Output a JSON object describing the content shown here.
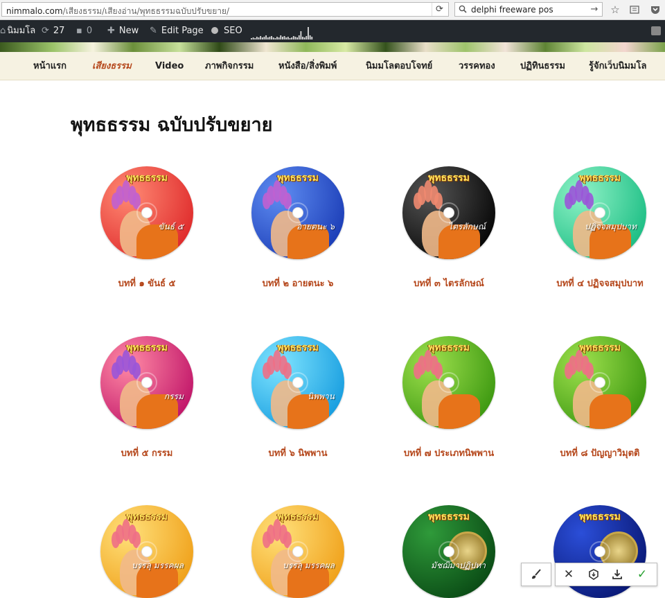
{
  "browser": {
    "url_host": "nimmalo.com",
    "url_path": "/เสียงธรรม/เสียงอ่าน/พุทธธรรมฉบับปรับขยาย/",
    "reload_glyph": "⟳",
    "search_query": "delphi freeware pos",
    "go_glyph": "→",
    "icons": [
      "star-icon",
      "reading-list-icon",
      "pocket-icon"
    ]
  },
  "admin_bar": {
    "site_name": "นิมมโล",
    "updates_count": "27",
    "comments_count": "0",
    "new_label": "New",
    "edit_label": "Edit Page",
    "seo_label": "SEO",
    "stats_bars": [
      2,
      3,
      2,
      4,
      3,
      5,
      3,
      4,
      6,
      3,
      4,
      5,
      3,
      2,
      4,
      3,
      6,
      4,
      5,
      3,
      4,
      2,
      3,
      5,
      4,
      3,
      6,
      12,
      4,
      3,
      5,
      18,
      6,
      4
    ]
  },
  "nav": {
    "items": [
      {
        "label": "หน้าแรก",
        "active": false
      },
      {
        "label": "เสียงธรรม",
        "active": true
      },
      {
        "label": "Video",
        "active": false
      },
      {
        "label": "ภาพกิจกรรม",
        "active": false
      },
      {
        "label": "หนังสือ/สิ่งพิมพ์",
        "active": false
      },
      {
        "label": "นิมมโลตอบโจทย์",
        "active": false
      },
      {
        "label": "วรรคทอง",
        "active": false
      },
      {
        "label": "ปฏิทินธรรม",
        "active": false
      },
      {
        "label": "รู้จักเว็บนิมมโล",
        "active": false
      }
    ]
  },
  "page": {
    "title": "พุทธธรรม ฉบับปรับขยาย"
  },
  "items": [
    {
      "caption": "บทที่ ๑ ขันธ์ ๕",
      "disc_label": "ขันธ์ ๕",
      "colors": [
        "#ff8a74",
        "#e02d2d"
      ],
      "flower": "#c060d0"
    },
    {
      "caption": "บทที่ ๒ อายตนะ ๖",
      "disc_label": "อายตนะ ๖",
      "colors": [
        "#5f8df2",
        "#1d3fb8"
      ],
      "flower": "#c060d0"
    },
    {
      "caption": "บทที่ ๓ ไตรลักษณ์",
      "disc_label": "ไตรลักษณ์",
      "colors": [
        "#555555",
        "#080808"
      ],
      "flower": "#f08a70"
    },
    {
      "caption": "บทที่ ๔ ปฏิจจสมุปบาท",
      "disc_label": "ปฏิจจสมุปบาท",
      "colors": [
        "#8ff2c6",
        "#1fbf86"
      ],
      "flower": "#9a55d8"
    },
    {
      "caption": "บทที่ ๕ กรรม",
      "disc_label": "กรรม",
      "colors": [
        "#ff8aa5",
        "#c2186a"
      ],
      "flower": "#9a55d8"
    },
    {
      "caption": "บทที่ ๖ นิพพาน",
      "disc_label": "นิพพาน",
      "colors": [
        "#7fe4ff",
        "#1a9fe0"
      ],
      "flower": "#ee6f86"
    },
    {
      "caption": "บทที่ ๗ ประเภทนิพพาน",
      "disc_label": "",
      "colors": [
        "#9ee04d",
        "#3f9a12"
      ],
      "flower": "#ee6f86"
    },
    {
      "caption": "บทที่ ๘ ปัญญาวิมุตติ",
      "disc_label": "",
      "colors": [
        "#9ee04d",
        "#3f9a12"
      ],
      "flower": "#ee6f86"
    },
    {
      "caption": "",
      "disc_label": "บรรลุ มรรคผล",
      "colors": [
        "#ffe07a",
        "#f0a21c"
      ],
      "flower": "#ee6f86"
    },
    {
      "caption": "",
      "disc_label": "บรรลุ มรรคผล",
      "colors": [
        "#ffe07a",
        "#f0a21c"
      ],
      "flower": "#ee6f86"
    },
    {
      "caption": "",
      "disc_label": "มัชฌิมาปฏิปทา",
      "colors": [
        "#2f9a3a",
        "#0b4d16"
      ],
      "flower": ""
    },
    {
      "caption": "",
      "disc_label": "",
      "colors": [
        "#2b4ed8",
        "#0a1a78"
      ],
      "flower": ""
    }
  ],
  "disc_brand": "พุทธธรรม",
  "float_toolbar": {
    "brush_glyph": "🖌",
    "close_glyph": "✕",
    "shield_glyph": "⬡",
    "download_glyph": "⤓",
    "check_glyph": "✓",
    "check_color": "#27a030"
  }
}
